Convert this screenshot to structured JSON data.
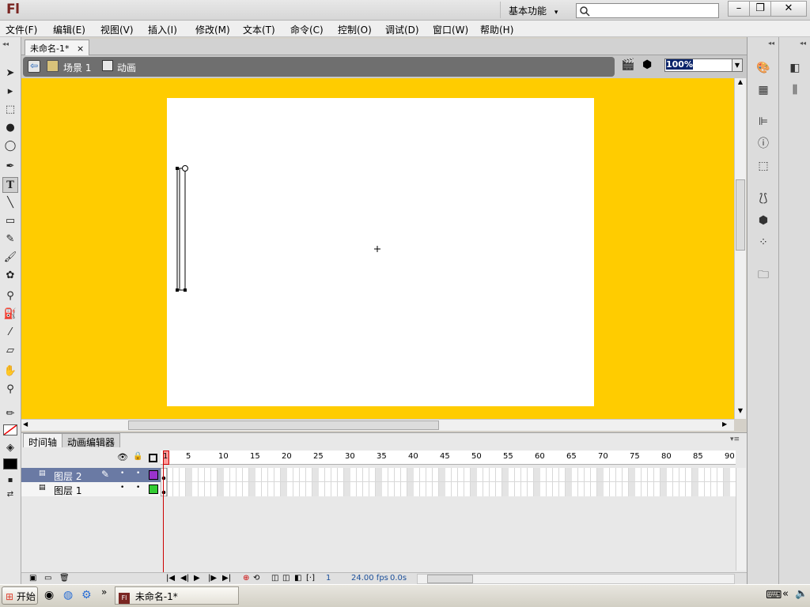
{
  "app": {
    "logo": "Fl",
    "workspace": "基本功能",
    "workspace_arrow": "▾",
    "search_placeholder": ""
  },
  "window_buttons": {
    "minimize": "–",
    "restore": "❐",
    "close": "✕"
  },
  "menu": [
    "文件(F)",
    "编辑(E)",
    "视图(V)",
    "插入(I)",
    "修改(M)",
    "文本(T)",
    "命令(C)",
    "控制(O)",
    "调试(D)",
    "窗口(W)",
    "帮助(H)"
  ],
  "document": {
    "tab_title": "未命名-1*",
    "tab_close": "×"
  },
  "editbar": {
    "scene": "场景 1",
    "symbol": "动画",
    "zoom": "100%"
  },
  "timeline": {
    "tabs": [
      "时间轴",
      "动画编辑器"
    ],
    "frame_numbers": [
      "1",
      "5",
      "10",
      "15",
      "20",
      "25",
      "30",
      "35",
      "40",
      "45",
      "50",
      "55",
      "60",
      "65",
      "70",
      "75",
      "80",
      "85",
      "90"
    ],
    "layers": [
      {
        "name": "图层 2",
        "selected": true,
        "color": "#9933cc"
      },
      {
        "name": "图层 1",
        "selected": false,
        "color": "#33cc33"
      }
    ],
    "status": {
      "frame": "1",
      "fps": "24.00 fps",
      "time": "0.0s"
    }
  },
  "taskbar": {
    "start": "开始",
    "task": "未命名-1*",
    "tray_arrow": "«"
  },
  "colors": {
    "pasteboard": "#ffcc00",
    "stage": "#ffffff",
    "selected_layer": "#6a7aa4"
  },
  "icons": {
    "tools": [
      "selection-tool-icon",
      "subselection-tool-icon",
      "free-transform-icon",
      "3d-rotation-icon",
      "lasso-icon",
      "pen-icon",
      "text-tool-icon",
      "line-tool-icon",
      "rectangle-icon",
      "pencil-icon",
      "brush-icon",
      "deco-icon",
      "bone-icon",
      "paint-bucket-icon",
      "eyedropper-icon",
      "eraser-icon",
      "hand-icon",
      "zoom-icon",
      "stroke-color-icon",
      "fill-color-icon"
    ],
    "right_panels": [
      "color-panel-icon",
      "swatches-icon",
      "align-icon",
      "info-icon",
      "transform-icon",
      "actions-icon",
      "components-icon",
      "motion-presets-icon",
      "library-icon"
    ]
  }
}
